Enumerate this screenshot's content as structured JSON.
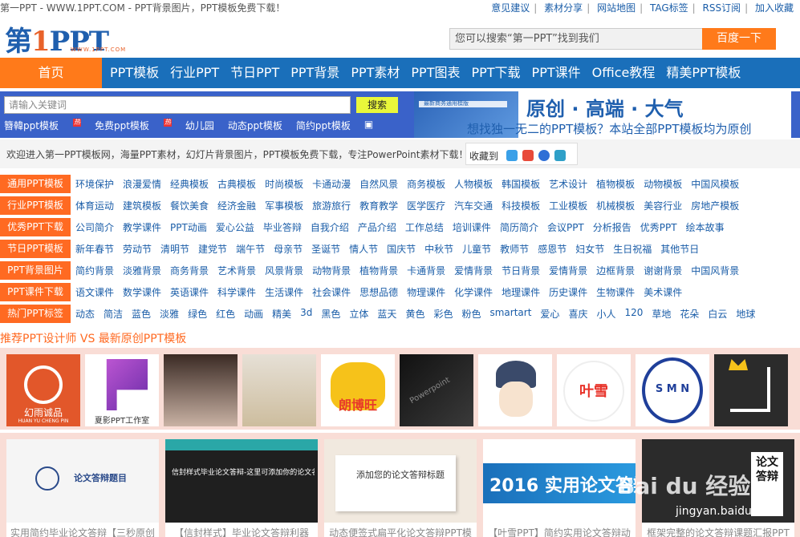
{
  "topbar": {
    "left": "第一PPT - WWW.1PPT.COM - PPT背景图片，PPT模板免费下载！",
    "links": [
      "意见建议",
      "素材分享",
      "网站地图",
      "TAG标签",
      "RSS订阅",
      "加入收藏"
    ]
  },
  "logo": {
    "main1": "第",
    "num": "1",
    "main2": "PPT",
    "sub": "WWW.1PPT.COM"
  },
  "top_search": {
    "placeholder": "您可以搜索“第一PPT”找到我们",
    "button": "百度一下"
  },
  "nav": {
    "home": "首页",
    "items": [
      "PPT模板",
      "行业PPT",
      "节日PPT",
      "PPT背景",
      "PPT素材",
      "PPT图表",
      "PPT下载",
      "PPT课件",
      "Office教程",
      "精美PPT模板"
    ]
  },
  "site_search": {
    "placeholder": "请输入关键词",
    "button": "搜索",
    "hot_tags": [
      "簪韓ppt模板",
      "免费ppt模板",
      "幼儿园",
      "动态ppt模板",
      "简约ppt模板"
    ],
    "hot_badge": "热"
  },
  "banner": {
    "headline": "原创 · 高端 · 大气",
    "subline": "想找独一无二的PPT模板？本站全部PPT模板均为原创",
    "thumb_title": "最新商务通用模版"
  },
  "welcome": {
    "text": "欢迎进入第一PPT模板网，海量PPT素材，幻灯片背景图片，PPT模板免费下载，专注PowerPoint素材下载！",
    "fav_label": "收藏到"
  },
  "categories": [
    {
      "label": "通用PPT模板",
      "items": [
        "环境保护",
        "浪漫爱情",
        "经典模板",
        "古典模板",
        "时尚模板",
        "卡通动漫",
        "自然风景",
        "商务模板",
        "人物模板",
        "韩国模板",
        "艺术设计",
        "植物模板",
        "动物模板",
        "中国风模板"
      ]
    },
    {
      "label": "行业PPT模板",
      "items": [
        "体育运动",
        "建筑模板",
        "餐饮美食",
        "经济金融",
        "军事模板",
        "旅游旅行",
        "教育教学",
        "医学医疗",
        "汽车交通",
        "科技模板",
        "工业模板",
        "机械模板",
        "美容行业",
        "房地产模板"
      ]
    },
    {
      "label": "优秀PPT下载",
      "items": [
        "公司简介",
        "教学课件",
        "PPT动画",
        "爱心公益",
        "毕业答辩",
        "自我介绍",
        "产品介绍",
        "工作总结",
        "培训课件",
        "简历简介",
        "会议PPT",
        "分析报告",
        "优秀PPT",
        "绘本故事"
      ]
    },
    {
      "label": "节日PPT模板",
      "items": [
        "新年春节",
        "劳动节",
        "清明节",
        "建党节",
        "端午节",
        "母亲节",
        "圣诞节",
        "情人节",
        "国庆节",
        "中秋节",
        "儿童节",
        "教师节",
        "感恩节",
        "妇女节",
        "生日祝福",
        "其他节日"
      ]
    },
    {
      "label": "PPT背景图片",
      "items": [
        "简约背景",
        "淡雅背景",
        "商务背景",
        "艺术背景",
        "风景背景",
        "动物背景",
        "植物背景",
        "卡通背景",
        "爱情背景",
        "节日背景",
        "爱情背景",
        "边框背景",
        "谢谢背景",
        "中国风背景"
      ]
    },
    {
      "label": "PPT课件下载",
      "items": [
        "语文课件",
        "数学课件",
        "英语课件",
        "科学课件",
        "生活课件",
        "社会课件",
        "思想品德",
        "物理课件",
        "化学课件",
        "地理课件",
        "历史课件",
        "生物课件",
        "美术课件"
      ]
    },
    {
      "label": "热门PPT标签",
      "items": [
        "动态",
        "简洁",
        "蓝色",
        "淡雅",
        "绿色",
        "红色",
        "动画",
        "精美",
        "3d",
        "黑色",
        "立体",
        "蓝天",
        "黄色",
        "彩色",
        "粉色",
        "smartart",
        "爱心",
        "喜庆",
        "小人",
        "120",
        "草地",
        "花朵",
        "白云",
        "地球"
      ]
    }
  ],
  "section_title": "推荐PPT设计师 VS 最新原创PPT模板",
  "designers": [
    {
      "name": "幻雨诚品",
      "sub": "HUAN YU CHENG PIN"
    },
    {
      "name": "夏影PPT工作室"
    },
    {
      "name": ""
    },
    {
      "name": ""
    },
    {
      "name": "朗博旺"
    },
    {
      "name": "Powerpoint"
    },
    {
      "name": ""
    },
    {
      "name": "叶雪"
    },
    {
      "name": "S M N"
    },
    {
      "name": ""
    }
  ],
  "templates": [
    {
      "caption": "实用简约毕业论文答辩【三秒原创",
      "img_text": "论文答辩题目"
    },
    {
      "caption": "【信封样式】毕业论文答辩利器",
      "img_text": "信封样式毕业论文答辩-这里可添加你的论文名称"
    },
    {
      "caption": "动态便签式扁平化论文答辩PPT模",
      "img_text": "添加您的论文答辩标题"
    },
    {
      "caption": "【叶雪PPT】简约实用论文答辩动",
      "img_text": "2016 实用论文答辩"
    },
    {
      "caption": "框架完整的论文答辩课题汇报PPT",
      "img_text": "论文答辩"
    }
  ],
  "watermark": {
    "brand": "Bai du 经验",
    "url": "jingyan.baidu.com"
  }
}
